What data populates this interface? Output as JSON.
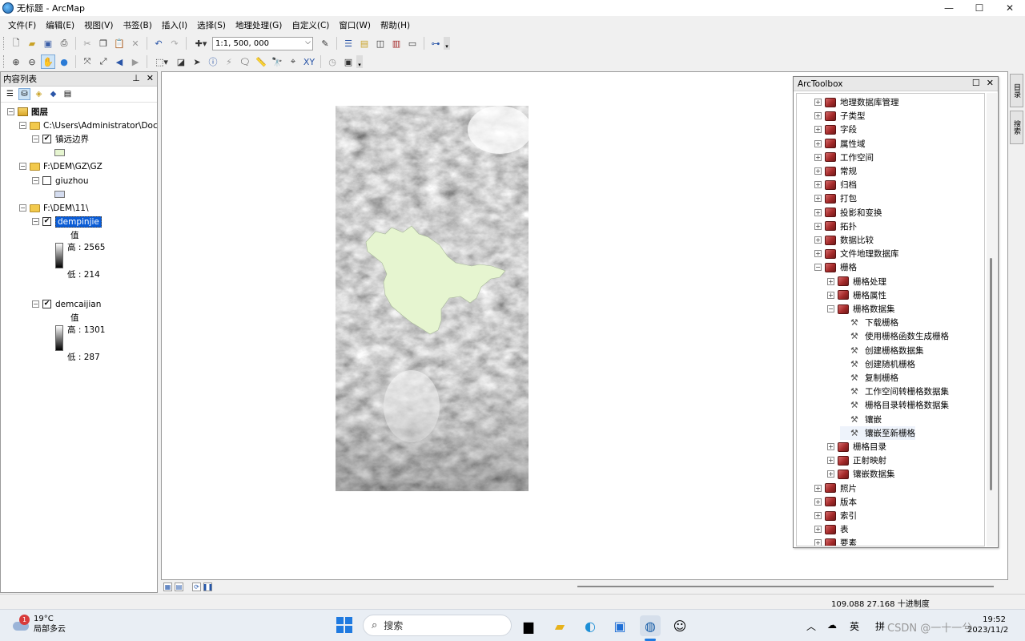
{
  "window": {
    "title": "无标题 - ArcMap",
    "minimize": "—",
    "maximize": "☐",
    "close": "✕"
  },
  "menu": [
    "文件(F)",
    "编辑(E)",
    "视图(V)",
    "书签(B)",
    "插入(I)",
    "选择(S)",
    "地理处理(G)",
    "自定义(C)",
    "窗口(W)",
    "帮助(H)"
  ],
  "toolbar": {
    "scale": "1:1, 500, 000"
  },
  "toc": {
    "title": "内容列表",
    "root": "图层",
    "group1": {
      "path": "C:\\Users\\Administrator\\Doc",
      "layer": "镇远边界",
      "layer_checked": true
    },
    "group2": {
      "path": "F:\\DEM\\GZ\\GZ",
      "layer": "giuzhou",
      "layer_checked": false
    },
    "group3": {
      "path": "F:\\DEM\\11\\",
      "layer1": {
        "name": "dempinjie",
        "checked": true,
        "value_label": "值",
        "high": "高 : 2565",
        "low": "低 : 214"
      },
      "layer2": {
        "name": "demcaijian",
        "checked": true,
        "value_label": "值",
        "high": "高 : 1301",
        "low": "低 : 287"
      }
    }
  },
  "colors": {
    "zhenyuan_fill": "#e6f5d0",
    "guizhou_fill": "#d4dcef",
    "selection": "#0a5cd6"
  },
  "toolbox": {
    "title": "ArcToolbox",
    "items": [
      {
        "label": "地理数据库管理",
        "level": 0,
        "kind": "toolbox",
        "exp": "+"
      },
      {
        "label": "子类型",
        "level": 0,
        "kind": "toolbox",
        "exp": "+"
      },
      {
        "label": "字段",
        "level": 0,
        "kind": "toolbox",
        "exp": "+"
      },
      {
        "label": "属性域",
        "level": 0,
        "kind": "toolbox",
        "exp": "+"
      },
      {
        "label": "工作空间",
        "level": 0,
        "kind": "toolbox",
        "exp": "+"
      },
      {
        "label": "常规",
        "level": 0,
        "kind": "toolbox",
        "exp": "+"
      },
      {
        "label": "归档",
        "level": 0,
        "kind": "toolbox",
        "exp": "+"
      },
      {
        "label": "打包",
        "level": 0,
        "kind": "toolbox",
        "exp": "+"
      },
      {
        "label": "投影和变换",
        "level": 0,
        "kind": "toolbox",
        "exp": "+"
      },
      {
        "label": "拓扑",
        "level": 0,
        "kind": "toolbox",
        "exp": "+"
      },
      {
        "label": "数据比较",
        "level": 0,
        "kind": "toolbox",
        "exp": "+"
      },
      {
        "label": "文件地理数据库",
        "level": 0,
        "kind": "toolbox",
        "exp": "+"
      },
      {
        "label": "栅格",
        "level": 0,
        "kind": "toolbox",
        "exp": "−"
      },
      {
        "label": "栅格处理",
        "level": 1,
        "kind": "toolbox",
        "exp": "+"
      },
      {
        "label": "栅格属性",
        "level": 1,
        "kind": "toolbox",
        "exp": "+"
      },
      {
        "label": "栅格数据集",
        "level": 1,
        "kind": "toolbox",
        "exp": "−"
      },
      {
        "label": "下载栅格",
        "level": 2,
        "kind": "tool"
      },
      {
        "label": "使用栅格函数生成栅格",
        "level": 2,
        "kind": "tool"
      },
      {
        "label": "创建栅格数据集",
        "level": 2,
        "kind": "tool"
      },
      {
        "label": "创建随机栅格",
        "level": 2,
        "kind": "tool"
      },
      {
        "label": "复制栅格",
        "level": 2,
        "kind": "tool"
      },
      {
        "label": "工作空间转栅格数据集",
        "level": 2,
        "kind": "tool"
      },
      {
        "label": "栅格目录转栅格数据集",
        "level": 2,
        "kind": "tool"
      },
      {
        "label": "镶嵌",
        "level": 2,
        "kind": "tool"
      },
      {
        "label": "镶嵌至新栅格",
        "level": 2,
        "kind": "tool",
        "highlight": true
      },
      {
        "label": "栅格目录",
        "level": 1,
        "kind": "toolbox",
        "exp": "+"
      },
      {
        "label": "正射映射",
        "level": 1,
        "kind": "toolbox",
        "exp": "+"
      },
      {
        "label": "镶嵌数据集",
        "level": 1,
        "kind": "toolbox",
        "exp": "+"
      },
      {
        "label": "照片",
        "level": 0,
        "kind": "toolbox",
        "exp": "+"
      },
      {
        "label": "版本",
        "level": 0,
        "kind": "toolbox",
        "exp": "+"
      },
      {
        "label": "索引",
        "level": 0,
        "kind": "toolbox",
        "exp": "+"
      },
      {
        "label": "表",
        "level": 0,
        "kind": "toolbox",
        "exp": "+"
      },
      {
        "label": "要素",
        "level": 0,
        "kind": "toolbox",
        "exp": "+"
      }
    ]
  },
  "dock": {
    "tab1": "目录",
    "tab2": "搜索"
  },
  "status": {
    "coords": "109.088  27.168 十进制度"
  },
  "taskbar": {
    "temp": "19°C",
    "weather": "局部多云",
    "weather_badge": "1",
    "search": "搜索",
    "ime1": "英",
    "ime2": "拼",
    "time": "19:52",
    "date": "2023/11/2",
    "watermark": "CSDN @一十一兮"
  }
}
